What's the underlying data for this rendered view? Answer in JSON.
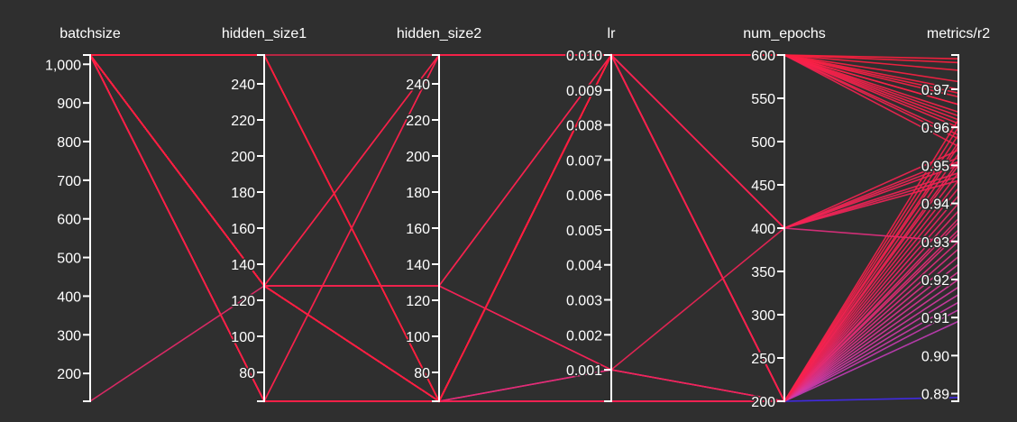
{
  "chart_data": {
    "type": "parallel_coordinates",
    "axes": [
      {
        "name": "batchsize",
        "range": [
          128,
          1024
        ],
        "ticks": [
          200,
          300,
          400,
          500,
          600,
          700,
          800,
          900,
          1000
        ],
        "tick_labels": [
          "200",
          "300",
          "400",
          "500",
          "600",
          "700",
          "800",
          "900",
          "1,000"
        ]
      },
      {
        "name": "hidden_size1",
        "range": [
          64,
          256
        ],
        "ticks": [
          80,
          100,
          120,
          140,
          160,
          180,
          200,
          220,
          240
        ],
        "tick_labels": [
          "80",
          "100",
          "120",
          "140",
          "160",
          "180",
          "200",
          "220",
          "240"
        ]
      },
      {
        "name": "hidden_size2",
        "range": [
          64,
          256
        ],
        "ticks": [
          80,
          100,
          120,
          140,
          160,
          180,
          200,
          220,
          240
        ],
        "tick_labels": [
          "80",
          "100",
          "120",
          "140",
          "160",
          "180",
          "200",
          "220",
          "240"
        ]
      },
      {
        "name": "lr",
        "range": [
          0.0001,
          0.01
        ],
        "ticks": [
          0.001,
          0.002,
          0.003,
          0.004,
          0.005,
          0.006,
          0.007,
          0.008,
          0.009,
          0.01
        ],
        "tick_labels": [
          "0.001",
          "0.002",
          "0.003",
          "0.004",
          "0.005",
          "0.006",
          "0.007",
          "0.008",
          "0.009",
          "0.010"
        ]
      },
      {
        "name": "num_epochs",
        "range": [
          200,
          600
        ],
        "ticks": [
          200,
          250,
          300,
          350,
          400,
          450,
          500,
          550,
          600
        ],
        "tick_labels": [
          "200",
          "250",
          "300",
          "350",
          "400",
          "450",
          "500",
          "550",
          "600"
        ]
      },
      {
        "name": "metrics/r2",
        "range": [
          0.888,
          0.979
        ],
        "ticks": [
          0.89,
          0.9,
          0.91,
          0.92,
          0.93,
          0.94,
          0.95,
          0.96,
          0.97
        ],
        "tick_labels": [
          "0.89",
          "0.90",
          "0.91",
          "0.92",
          "0.93",
          "0.94",
          "0.95",
          "0.96",
          "0.97"
        ]
      }
    ],
    "color_metric": "metrics/r2",
    "colorscale": [
      "#2222ff",
      "#9b3fd6",
      "#d63aa6",
      "#f0245a",
      "#ff1f3d"
    ],
    "runs": [
      [
        1024,
        256,
        64,
        0.01,
        600,
        0.975
      ],
      [
        1024,
        256,
        64,
        0.01,
        600,
        0.972
      ],
      [
        1024,
        256,
        64,
        0.01,
        600,
        0.97
      ],
      [
        1024,
        128,
        64,
        0.01,
        600,
        0.968
      ],
      [
        1024,
        128,
        64,
        0.01,
        600,
        0.966
      ],
      [
        1024,
        128,
        128,
        0.01,
        600,
        0.964
      ],
      [
        1024,
        128,
        64,
        0.01,
        600,
        0.963
      ],
      [
        1024,
        64,
        256,
        0.01,
        600,
        0.962
      ],
      [
        1024,
        64,
        64,
        0.01,
        600,
        0.961
      ],
      [
        1024,
        256,
        256,
        0.01,
        600,
        0.96
      ],
      [
        1024,
        128,
        64,
        0.01,
        600,
        0.958
      ],
      [
        1024,
        64,
        64,
        0.01,
        600,
        0.957
      ],
      [
        1024,
        256,
        64,
        0.01,
        600,
        0.955
      ],
      [
        1024,
        128,
        64,
        0.01,
        400,
        0.954
      ],
      [
        1024,
        128,
        64,
        0.01,
        400,
        0.952
      ],
      [
        1024,
        256,
        64,
        0.01,
        400,
        0.951
      ],
      [
        1024,
        64,
        64,
        0.01,
        400,
        0.95
      ],
      [
        1024,
        128,
        128,
        0.001,
        400,
        0.948
      ],
      [
        1024,
        128,
        256,
        0.01,
        400,
        0.947
      ],
      [
        1024,
        128,
        64,
        0.01,
        400,
        0.946
      ],
      [
        1024,
        64,
        64,
        0.01,
        200,
        0.962
      ],
      [
        1024,
        128,
        64,
        0.01,
        200,
        0.96
      ],
      [
        1024,
        128,
        64,
        0.01,
        200,
        0.958
      ],
      [
        1024,
        64,
        256,
        0.01,
        200,
        0.956
      ],
      [
        1024,
        256,
        64,
        0.0001,
        200,
        0.955
      ],
      [
        1024,
        128,
        64,
        0.0001,
        200,
        0.953
      ],
      [
        1024,
        128,
        64,
        0.01,
        200,
        0.951
      ],
      [
        1024,
        64,
        64,
        0.0001,
        200,
        0.95
      ],
      [
        1024,
        128,
        128,
        0.001,
        200,
        0.948
      ],
      [
        1024,
        128,
        64,
        0.01,
        200,
        0.946
      ],
      [
        1024,
        64,
        64,
        0.01,
        200,
        0.944
      ],
      [
        1024,
        128,
        64,
        0.0001,
        200,
        0.942
      ],
      [
        1024,
        64,
        64,
        0.01,
        200,
        0.94
      ],
      [
        128,
        128,
        128,
        0.01,
        200,
        0.938
      ],
      [
        1024,
        128,
        64,
        0.0001,
        200,
        0.936
      ],
      [
        1024,
        128,
        64,
        0.001,
        200,
        0.935
      ],
      [
        1024,
        128,
        64,
        0.01,
        200,
        0.933
      ],
      [
        1024,
        64,
        64,
        0.0001,
        200,
        0.932
      ],
      [
        1024,
        128,
        64,
        0.01,
        200,
        0.93
      ],
      [
        1024,
        64,
        64,
        0.0001,
        200,
        0.928
      ],
      [
        1024,
        128,
        64,
        0.01,
        400,
        0.93
      ],
      [
        1024,
        64,
        64,
        0.0001,
        200,
        0.926
      ],
      [
        1024,
        128,
        64,
        0.01,
        200,
        0.924
      ],
      [
        1024,
        64,
        64,
        0.0001,
        200,
        0.922
      ],
      [
        1024,
        128,
        64,
        0.01,
        200,
        0.92
      ],
      [
        1024,
        64,
        64,
        0.0001,
        200,
        0.918
      ],
      [
        1024,
        128,
        64,
        0.001,
        200,
        0.916
      ],
      [
        1024,
        64,
        64,
        0.01,
        200,
        0.914
      ],
      [
        1024,
        128,
        64,
        0.0001,
        200,
        0.912
      ],
      [
        1024,
        64,
        64,
        0.01,
        200,
        0.909
      ],
      [
        1024,
        128,
        64,
        0.0001,
        200,
        0.889
      ],
      [
        1024,
        256,
        64,
        0.01,
        600,
        0.978
      ],
      [
        1024,
        128,
        64,
        0.01,
        600,
        0.977
      ],
      [
        1024,
        64,
        64,
        0.01,
        600,
        0.969
      ],
      [
        1024,
        128,
        256,
        0.01,
        600,
        0.966
      ]
    ]
  }
}
